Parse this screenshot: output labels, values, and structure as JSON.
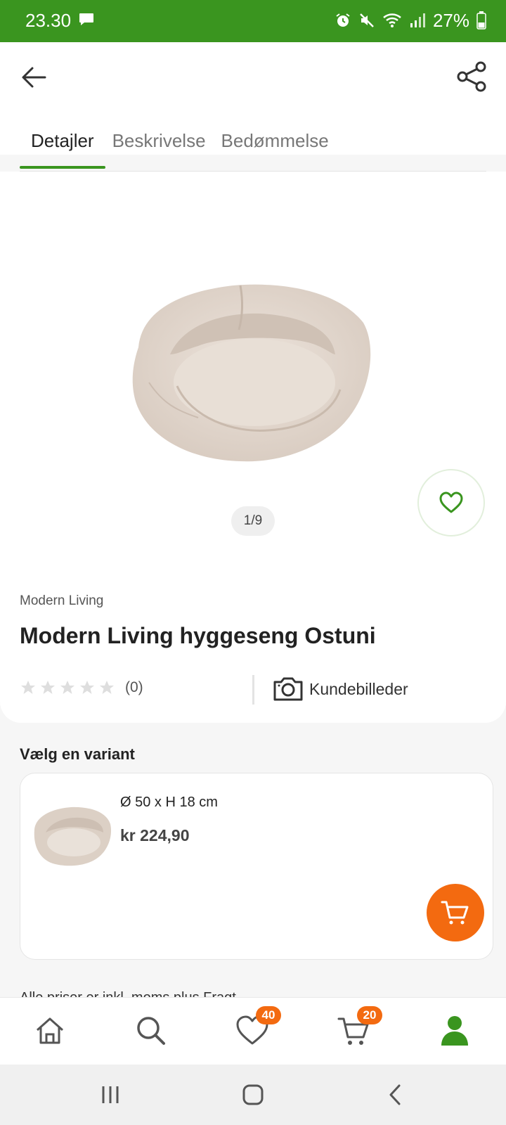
{
  "status_bar": {
    "time": "23.30",
    "battery_percent": "27%",
    "icons": [
      "message-icon",
      "alarm-icon",
      "mute-icon",
      "wifi-icon",
      "signal-icon",
      "battery-icon"
    ]
  },
  "header": {
    "back_icon": "arrow-left-icon",
    "share_icon": "share-icon"
  },
  "tabs": [
    {
      "label": "Detajler",
      "active": true
    },
    {
      "label": "Beskrivelse",
      "active": false
    },
    {
      "label": "Bedømmelse",
      "active": false
    }
  ],
  "product": {
    "image_counter": "1/9",
    "brand": "Modern Living",
    "title": "Modern Living hyggeseng Ostuni",
    "rating_stars": 0,
    "rating_count": "(0)",
    "customer_images_label": "Kundebilleder"
  },
  "variants": {
    "heading": "Vælg en variant",
    "items": [
      {
        "size": "Ø 50 x H 18 cm",
        "price": "kr 224,90"
      }
    ]
  },
  "price_note": "Alle priser er inkl. moms plus Fragt",
  "bottom_nav": {
    "items": [
      {
        "icon": "home-icon"
      },
      {
        "icon": "search-icon"
      },
      {
        "icon": "heart-icon",
        "badge": "40"
      },
      {
        "icon": "cart-icon",
        "badge": "20"
      },
      {
        "icon": "user-icon",
        "active": true
      }
    ]
  },
  "colors": {
    "brand_green": "#3a951f",
    "accent_orange": "#f36a10"
  }
}
